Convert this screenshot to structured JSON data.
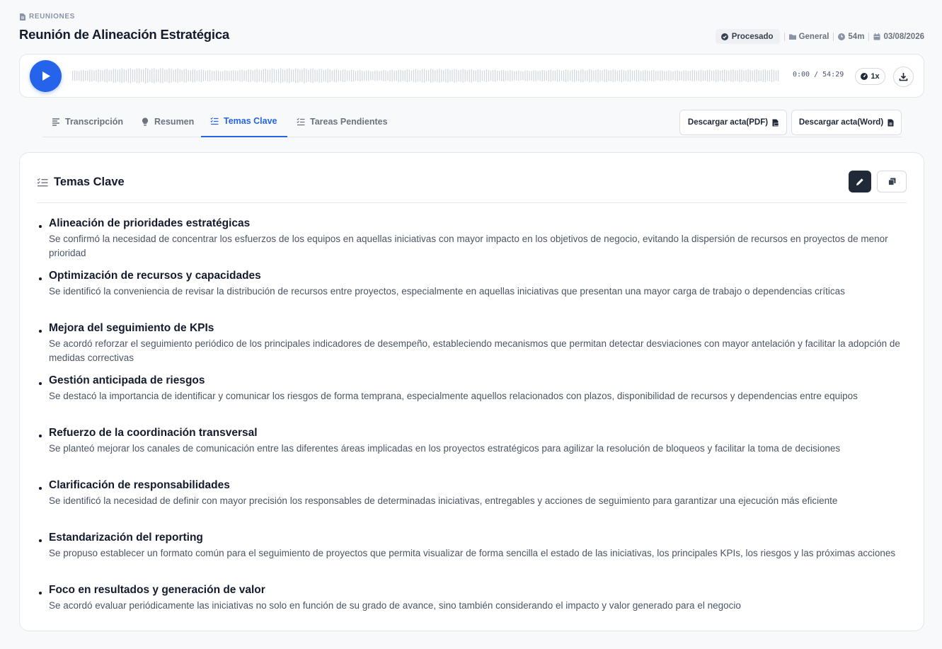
{
  "breadcrumb": {
    "label": "REUNIONES",
    "icon": "document-icon"
  },
  "page_title": "Reunión de Alineación Estratégica",
  "meta": {
    "status": "Procesado",
    "folder": "General",
    "duration": "54m",
    "date": "03/08/2026"
  },
  "player": {
    "time": "0:00 / 54:29",
    "speed": "1x",
    "accent": "#2563eb"
  },
  "tabs": [
    {
      "label": "Transcripción",
      "icon": "align-left-icon"
    },
    {
      "label": "Resumen",
      "icon": "lightbulb-icon"
    },
    {
      "label": "Temas Clave",
      "icon": "checklist-icon",
      "active": true
    },
    {
      "label": "Tareas Pendientes",
      "icon": "checklist-icon"
    }
  ],
  "export": {
    "pdf": "Descargar acta(PDF)",
    "word": "Descargar acta(Word)"
  },
  "card": {
    "title": "Temas Clave",
    "topics": [
      {
        "title": "Alineación de prioridades estratégicas",
        "desc": "Se confirmó la necesidad de concentrar los esfuerzos de los equipos en aquellas iniciativas con mayor impacto en los objetivos de negocio, evitando la dispersión de recursos en proyectos de menor prioridad"
      },
      {
        "title": "Optimización de recursos y capacidades",
        "desc": "Se identificó la conveniencia de revisar la distribución de recursos entre proyectos, especialmente en aquellas iniciativas que presentan una mayor carga de trabajo o dependencias críticas"
      },
      {
        "title": "Mejora del seguimiento de KPIs",
        "desc": "Se acordó reforzar el seguimiento periódico de los principales indicadores de desempeño, estableciendo mecanismos que permitan detectar desviaciones con mayor antelación y facilitar la adopción de medidas correctivas"
      },
      {
        "title": "Gestión anticipada de riesgos",
        "desc": "Se destacó la importancia de identificar y comunicar los riesgos de forma temprana, especialmente aquellos relacionados con plazos, disponibilidad de recursos y dependencias entre equipos"
      },
      {
        "title": "Refuerzo de la coordinación transversal",
        "desc": "Se planteó mejorar los canales de comunicación entre las diferentes áreas implicadas en los proyectos estratégicos para agilizar la resolución de bloqueos y facilitar la toma de decisiones"
      },
      {
        "title": "Clarificación de responsabilidades",
        "desc": "Se identificó la necesidad de definir con mayor precisión los responsables de determinadas iniciativas, entregables y acciones de seguimiento para garantizar una ejecución más eficiente"
      },
      {
        "title": "Estandarización del reporting",
        "desc": "Se propuso establecer un formato común para el seguimiento de proyectos que permita visualizar de forma sencilla el estado de las iniciativas, los principales KPIs, los riesgos y las próximas acciones"
      },
      {
        "title": "Foco en resultados y generación de valor",
        "desc": "Se acordó evaluar periódicamente las iniciativas no solo en función de su grado de avance, sino también considerando el impacto y valor generado para el negocio"
      }
    ]
  }
}
